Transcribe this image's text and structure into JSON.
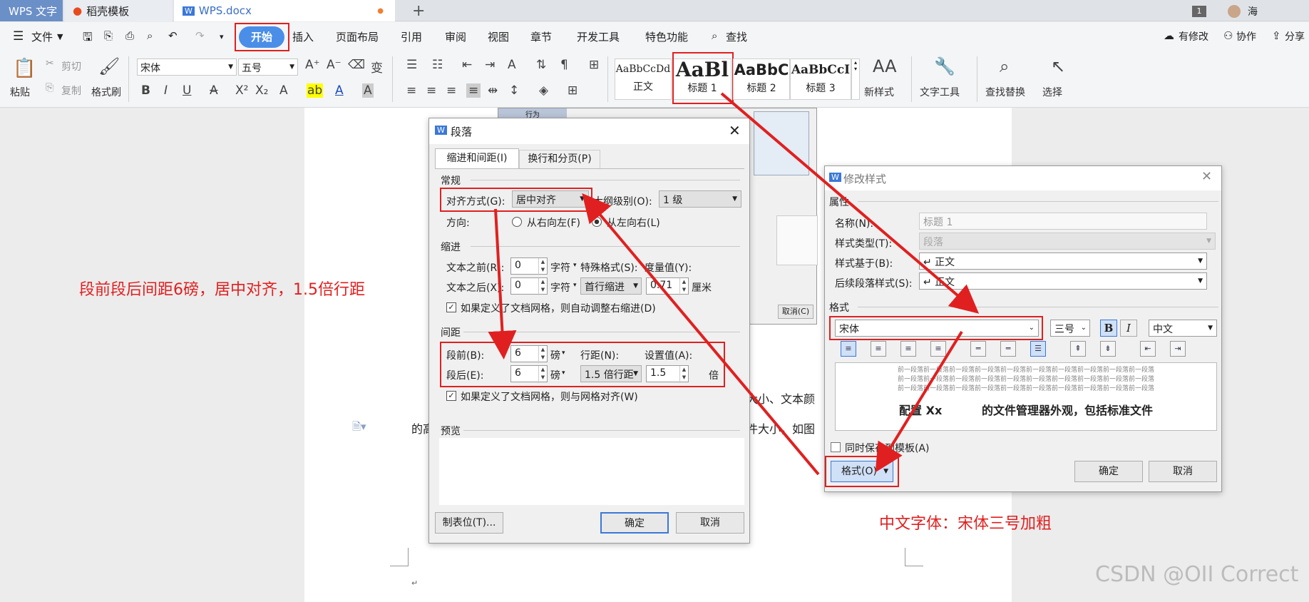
{
  "tabs": [
    {
      "label": "WPS 文字",
      "active": false
    },
    {
      "label": "稻壳模板"
    },
    {
      "label": "WPS.docx"
    }
  ],
  "tabbar": {
    "add": "+",
    "badge": "1",
    "user": "海"
  },
  "menubar": {
    "file": "文件",
    "items": [
      "开始",
      "插入",
      "页面布局",
      "引用",
      "审阅",
      "视图",
      "章节",
      "开发工具",
      "特色功能"
    ],
    "search": "查找",
    "right": [
      "有修改",
      "协作",
      "分享"
    ]
  },
  "ribbon": {
    "paste": "粘贴",
    "cut": "剪切",
    "copy": "复制",
    "format_painter": "格式刷",
    "font_name": "宋体",
    "font_size": "五号",
    "styles": [
      {
        "preview": "AaBbCcDd",
        "label": "正文"
      },
      {
        "preview": "AaBl",
        "label": "标题 1"
      },
      {
        "preview": "AaBbC",
        "label": "标题 2"
      },
      {
        "preview": "AaBbCcI",
        "label": "标题 3"
      }
    ],
    "new_style": "新样式",
    "text_tools": "文字工具",
    "find_replace": "查找替换",
    "select": "选择"
  },
  "para_dialog": {
    "title": "段落",
    "tabs": [
      "缩进和间距(I)",
      "换行和分页(P)"
    ],
    "general": "常规",
    "align_label": "对齐方式(G):",
    "align_value": "居中对齐",
    "outline_label": "大纲级别(O):",
    "outline_value": "1 级",
    "direction_label": "方向:",
    "rtl": "从右向左(F)",
    "ltr": "从左向右(L)",
    "indent": "缩进",
    "before_text": "文本之前(R):",
    "before_val": "0",
    "after_text": "文本之后(X):",
    "after_val": "0",
    "unit_char": "字符",
    "special": "特殊格式(S):",
    "special_val": "首行缩进",
    "measure": "度量值(Y):",
    "measure_val": "0.71",
    "unit_cm": "厘米",
    "auto_indent": "如果定义了文档网格，则自动调整右缩进(D)",
    "spacing": "间距",
    "before": "段前(B):",
    "before_spacing": "6",
    "after": "段后(E):",
    "after_spacing": "6",
    "unit_pt": "磅",
    "line_spacing": "行距(N):",
    "line_val": "1.5 倍行距",
    "set_value": "设置值(A):",
    "set_val": "1.5",
    "unit_times": "倍",
    "grid_align": "如果定义了文档网格，则与网格对齐(W)",
    "preview": "预览",
    "tabs_btn": "制表位(T)...",
    "ok": "确定",
    "cancel": "取消"
  },
  "style_dialog": {
    "title": "修改样式",
    "props": "属性",
    "name_label": "名称(N):",
    "name_val": "标题 1",
    "type_label": "样式类型(T):",
    "type_val": "段落",
    "based_label": "样式基于(B):",
    "based_val": "↵ 正文",
    "next_label": "后续段落样式(S):",
    "next_val": "↵ 正文",
    "format": "格式",
    "font": "宋体",
    "size": "三号",
    "bold": "B",
    "italic": "I",
    "lang": "中文",
    "preview_line": "前一段落前一段落前一段落前一段落前一段落前一段落前一段落前一段落前一段落前一段落",
    "preview_main": "配置 Xx          的文件管理器外观，包括标准文件",
    "save_template": "同时保存到模板(A)",
    "format_btn": "格式(O)",
    "ok": "确定",
    "cancel": "取消"
  },
  "bg_dialog": {
    "head": "行为",
    "btn": "取消(C)"
  },
  "doc": {
    "text1": "大小、文本颜",
    "text2": "的高",
    "text3": "件大小，如图"
  },
  "annotations": {
    "left": "段前段后间距6磅，居中对齐，1.5倍行距",
    "right": "中文字体：宋体三号加粗"
  },
  "watermark": "CSDN @OII Correct"
}
